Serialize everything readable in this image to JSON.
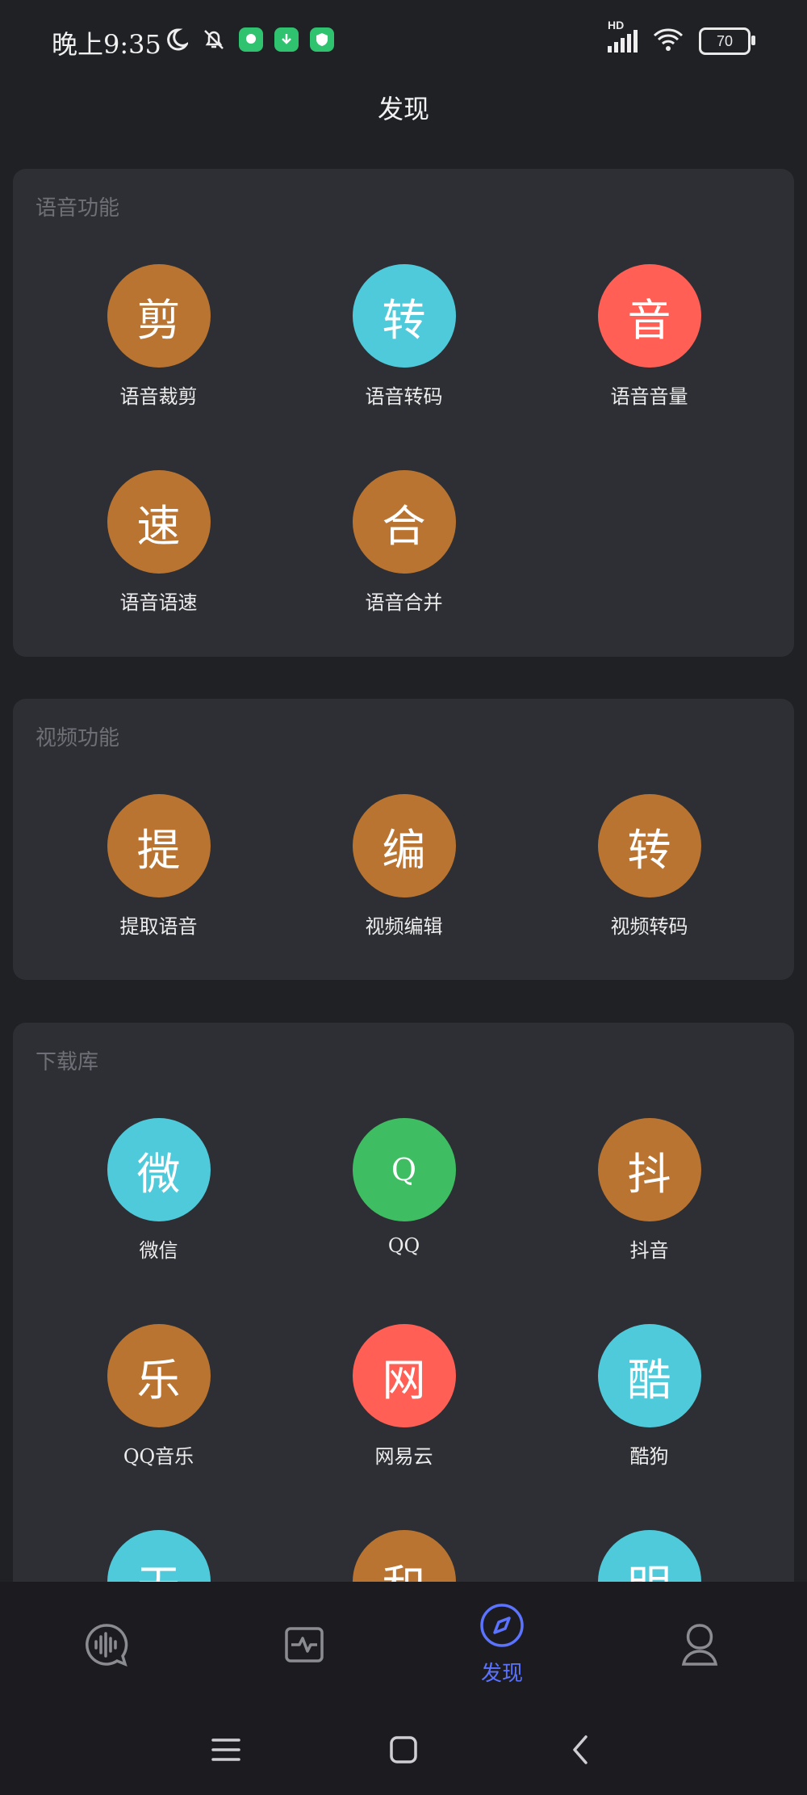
{
  "status_bar": {
    "time": "晚上9:35",
    "battery": "70",
    "signal_label": "HD"
  },
  "page_title": "发现",
  "colors": {
    "orange": "#b97431",
    "cyan": "#4ecadb",
    "red": "#ff5f55",
    "green": "#3fbd62",
    "accent_blue": "#5b73ff"
  },
  "sections": {
    "voice": {
      "title": "语音功能",
      "items": [
        {
          "glyph": "剪",
          "label": "语音裁剪",
          "color": "orange"
        },
        {
          "glyph": "转",
          "label": "语音转码",
          "color": "cyan"
        },
        {
          "glyph": "音",
          "label": "语音音量",
          "color": "red"
        },
        {
          "glyph": "速",
          "label": "语音语速",
          "color": "orange"
        },
        {
          "glyph": "合",
          "label": "语音合并",
          "color": "orange"
        }
      ]
    },
    "video": {
      "title": "视频功能",
      "items": [
        {
          "glyph": "提",
          "label": "提取语音",
          "color": "orange"
        },
        {
          "glyph": "编",
          "label": "视频编辑",
          "color": "orange"
        },
        {
          "glyph": "转",
          "label": "视频转码",
          "color": "orange"
        }
      ]
    },
    "download": {
      "title": "下载库",
      "items": [
        {
          "glyph": "微",
          "label": "微信",
          "color": "cyan"
        },
        {
          "glyph": "Q",
          "label": "QQ",
          "color": "green"
        },
        {
          "glyph": "抖",
          "label": "抖音",
          "color": "orange"
        },
        {
          "glyph": "乐",
          "label": "QQ音乐",
          "color": "orange"
        },
        {
          "glyph": "网",
          "label": "网易云",
          "color": "red"
        },
        {
          "glyph": "酷",
          "label": "酷狗",
          "color": "cyan"
        },
        {
          "glyph": "天",
          "label": "",
          "color": "cyan"
        },
        {
          "glyph": "和",
          "label": "",
          "color": "orange"
        },
        {
          "glyph": "明",
          "label": "",
          "color": "cyan"
        }
      ]
    }
  },
  "bottom_nav": {
    "items": [
      {
        "icon": "voice-bubble-icon"
      },
      {
        "icon": "activity-monitor-icon"
      },
      {
        "icon": "compass-icon",
        "label": "发现",
        "active": true
      },
      {
        "icon": "profile-icon"
      }
    ]
  }
}
